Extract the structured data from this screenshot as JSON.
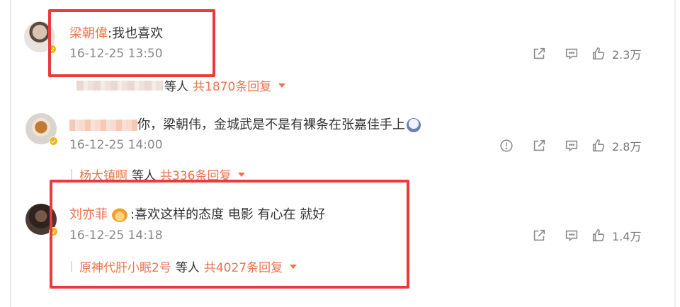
{
  "comments": [
    {
      "username": "梁朝偉",
      "text": ":我也喜欢",
      "time": "16-12-25 13:50",
      "likes": "2.3万",
      "reply_users": "",
      "reply_mid": "等人",
      "reply_total": "共1870条回复",
      "highlighted": true
    },
    {
      "username": "",
      "text": "你，梁朝伟，金城武是不是有裸条在张嘉佳手上",
      "time": "16-12-25 14:00",
      "likes": "2.8万",
      "reply_users": "杨大镇啊",
      "reply_mid": "等人",
      "reply_total": "共336条回复",
      "highlighted": false
    },
    {
      "username": "刘亦菲",
      "text": ":喜欢这样的态度 电影 有心在 就好",
      "time": "16-12-25 14:18",
      "likes": "1.4万",
      "reply_users": "原神代肝小眠2号",
      "reply_mid": "等人",
      "reply_total": "共4027条回复",
      "highlighted": true
    }
  ],
  "icons": {
    "repost": "repost-icon",
    "comment": "comment-icon",
    "like": "thumbs-up-icon",
    "report": "report-icon",
    "verified": "verified-badge-icon"
  },
  "colors": {
    "username": "#eb7350",
    "highlight_box": "#ea3b3b",
    "verified_badge": "#f7b500"
  }
}
